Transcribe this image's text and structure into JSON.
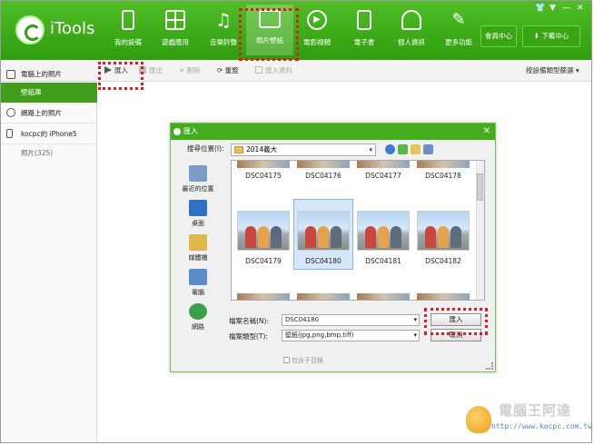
{
  "header": {
    "brand": "iTools",
    "nav": [
      {
        "label": "我的設備",
        "icon": "phone-icon"
      },
      {
        "label": "遊戲應用",
        "icon": "apps-grid-icon"
      },
      {
        "label": "音樂鈴聲",
        "icon": "music-note-icon"
      },
      {
        "label": "照片壁紙",
        "icon": "picture-icon",
        "active": true
      },
      {
        "label": "電影視頻",
        "icon": "play-circle-icon"
      },
      {
        "label": "電子書",
        "icon": "book-icon"
      },
      {
        "label": "個人資訊",
        "icon": "person-icon"
      },
      {
        "label": "更多功能",
        "icon": "wrench-icon"
      }
    ],
    "member_center": "會員中心",
    "download_center": "下載中心",
    "window_controls": {
      "shirt": "👕",
      "menu": "▼",
      "minimize": "—",
      "close": "✕"
    }
  },
  "toolbar": {
    "import": "匯入",
    "export": "匯出",
    "delete": "刪除",
    "refresh": "重整",
    "import_folder": "匯入資料",
    "filter": "按設備類型篩選"
  },
  "sidebar": {
    "pc_photos": "電腦上的照片",
    "wallpaper": "壁紙庫",
    "web_photos": "網路上的照片",
    "device": "kocpc的 iPhone5",
    "photos_count": "照片(325)"
  },
  "dialog": {
    "title": "匯入",
    "close": "✕",
    "look_in_label": "搜尋位置(I):",
    "look_in_value": "2014義大",
    "places": [
      "最近的位置",
      "桌面",
      "媒體櫃",
      "電腦",
      "網路"
    ],
    "files": [
      "DSC04175",
      "DSC04176",
      "DSC04177",
      "DSC04178",
      "DSC04179",
      "DSC04180",
      "DSC04181",
      "DSC04182"
    ],
    "selected_file": "DSC04180",
    "filename_label": "檔案名稱(N):",
    "filename_value": "DSC04180",
    "filetype_label": "檔案類型(T):",
    "filetype_value": "壁紙(jpg,png,bmp,tiff)",
    "open_button": "匯入",
    "cancel_button": "取消",
    "subdir_checkbox": "包含子目錄"
  },
  "watermark": {
    "title": "電腦王阿達",
    "url": "http://www.kocpc.com.tw"
  },
  "colors": {
    "header_green": "#3aa413",
    "accent_green": "#3f9f1c",
    "highlight_red": "#e01b1b",
    "selection_blue": "#d5e8fb"
  }
}
